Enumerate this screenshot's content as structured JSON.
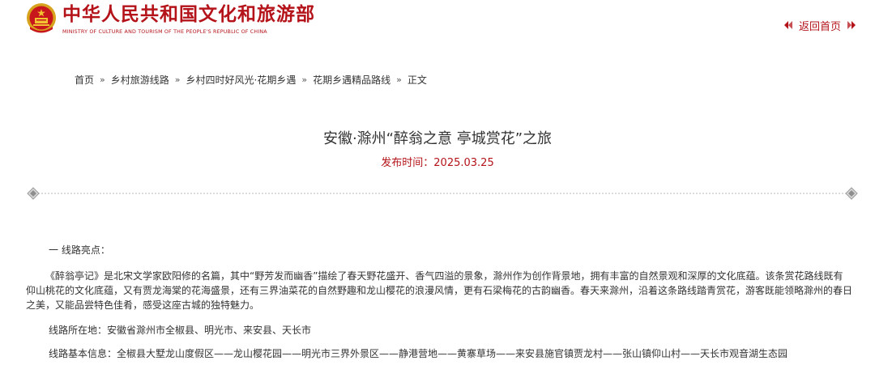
{
  "header": {
    "site_title": "中华人民共和国文化和旅游部",
    "site_subtitle": "MINISTRY OF CULTURE AND TOURISM OF THE PEOPLE'S REPUBLIC OF CHINA",
    "back_home_label": "返回首页",
    "brand_color": "#b4131a",
    "emblem_icon": "national-emblem-icon"
  },
  "breadcrumb": {
    "items": [
      "首页",
      "乡村旅游线路",
      "乡村四时好风光·花期乡遇",
      "花期乡遇精品路线",
      "正文"
    ],
    "separator": "»"
  },
  "article": {
    "title": "安徽·滁州“醉翁之意 亭城赏花”之旅",
    "date_label": "发布时间：2025.03.25",
    "section_heading": "一  线路亮点：",
    "body": "《醉翁亭记》是北宋文学家欧阳修的名篇，其中“野芳发而幽香”描绘了春天野花盛开、香气四溢的景象，滁州作为创作背景地，拥有丰富的自然景观和深厚的文化底蕴。该条赏花路线既有仰山桃花的文化底蕴，又有贾龙海棠的花海盛景，还有三界油菜花的自然野趣和龙山樱花的浪漫风情，更有石梁梅花的古韵幽香。春天来滁州，沿着这条路线踏青赏花，游客既能领略滁州的春日之美，又能品尝特色佳肴，感受这座古城的独特魅力。",
    "location": "线路所在地：安徽省滁州市全椒县、明光市、来安县、天长市",
    "route": "线路基本信息：全椒县大墅龙山度假区——龙山樱花园——明光市三界外景区——静港营地——黄寨草场——来安县施官镇贾龙村——张山镇仰山村——天长市观音湖生态园"
  }
}
